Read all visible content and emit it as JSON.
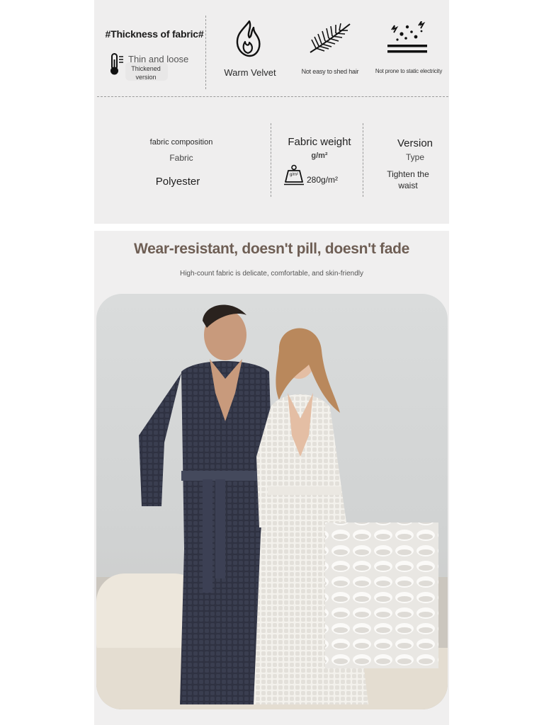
{
  "features": {
    "thickness_title": "#Thickness of fabric#",
    "thickness_option": "Thin and loose",
    "thickness_selected": "Thickened version",
    "items": [
      {
        "icon": "flame-icon",
        "label": "Warm Velvet"
      },
      {
        "icon": "feather-icon",
        "label": "Not easy to shed hair"
      },
      {
        "icon": "static-icon",
        "label": "Not prone to static electricity"
      }
    ]
  },
  "composition": {
    "fabric_label": "fabric composition",
    "fabric_sub": "Fabric",
    "fabric_value": "Polyester",
    "weight_label": "Fabric weight",
    "weight_unit": "g/m²",
    "weight_badge": "g/m²",
    "weight_value": "280g/m²",
    "version_label": "Version",
    "version_sub": "Type",
    "version_value": "Tighten the waist"
  },
  "showcase": {
    "headline": "Wear-resistant, doesn't pill, doesn't fade",
    "subline": "High-count fabric is delicate, comfortable, and skin-friendly"
  },
  "colors": {
    "panel_bg": "#efeeee",
    "headline": "#6e5e54",
    "dark_robe": "#2e3140",
    "light_robe": "#f4f2ee"
  }
}
